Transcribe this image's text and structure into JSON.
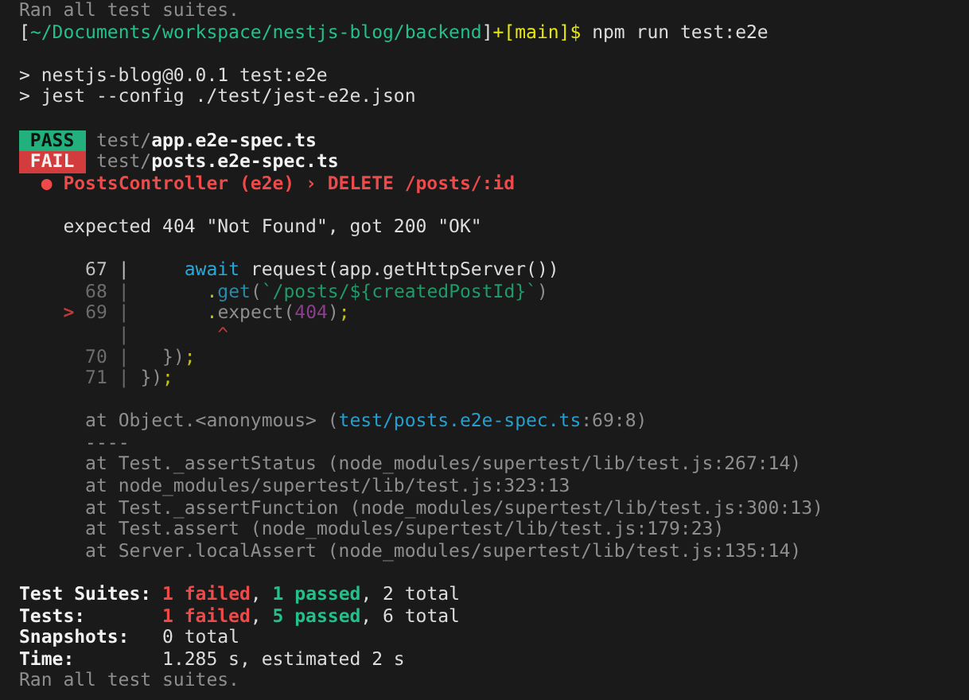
{
  "terminal": {
    "blocks": [
      {
        "lines": [
          {
            "segments": [
              {
                "kind": "dim",
                "text": "Ran all test suites."
              }
            ]
          },
          {
            "segments": [
              {
                "kind": "plain",
                "text": "["
              },
              {
                "kind": "path",
                "text": "~/Documents/workspace/nestjs-blog/backend"
              },
              {
                "kind": "plain",
                "text": "]"
              },
              {
                "kind": "branch",
                "text": "+[main]$"
              },
              {
                "kind": "plain",
                "text": " npm run test:e2e"
              }
            ]
          }
        ]
      },
      {
        "lines": [
          {
            "segments": [
              {
                "kind": "plain",
                "text": "> nestjs-blog@0.0.1 test:e2e"
              }
            ]
          },
          {
            "segments": [
              {
                "kind": "plain",
                "text": "> jest --config ./test/jest-e2e.json"
              }
            ]
          }
        ]
      },
      {
        "lines": [
          {
            "segments": [
              {
                "kind": "badge-pass",
                "text": "PASS"
              },
              {
                "kind": "dim",
                "text": " test/"
              },
              {
                "kind": "bold",
                "text": "app.e2e-spec.ts"
              }
            ]
          },
          {
            "segments": [
              {
                "kind": "badge-fail",
                "text": "FAIL"
              },
              {
                "kind": "dim",
                "text": " test/"
              },
              {
                "kind": "bold",
                "text": "posts.e2e-spec.ts"
              }
            ]
          },
          {
            "segments": [
              {
                "kind": "error",
                "text": "  ● PostsController (e2e) › DELETE /posts/:id"
              }
            ]
          }
        ]
      },
      {
        "lines": [
          {
            "segments": [
              {
                "kind": "plain",
                "text": "    expected 404 \"Not Found\", got 200 \"OK\""
              }
            ]
          }
        ]
      },
      {
        "lines": [
          {
            "segments": [
              {
                "kind": "linenum",
                "text": "      67 |"
              },
              {
                "kind": "keyword",
                "text": "     await"
              },
              {
                "kind": "plain",
                "text": " request(app.getHttpServer())"
              }
            ]
          },
          {
            "segments": [
              {
                "kind": "dimnum",
                "text": "      68 |"
              },
              {
                "kind": "punct",
                "text": "       ."
              },
              {
                "kind": "method",
                "text": "get"
              },
              {
                "kind": "dim",
                "text": "("
              },
              {
                "kind": "string",
                "text": "`/posts/${createdPostId}`"
              },
              {
                "kind": "dim",
                "text": ")"
              }
            ]
          },
          {
            "segments": [
              {
                "kind": "marker",
                "text": "    >"
              },
              {
                "kind": "dimnum",
                "text": " 69 |"
              },
              {
                "kind": "punct",
                "text": "       ."
              },
              {
                "kind": "dim",
                "text": "expect("
              },
              {
                "kind": "number",
                "text": "404"
              },
              {
                "kind": "dim",
                "text": ")"
              },
              {
                "kind": "punct",
                "text": ";"
              }
            ]
          },
          {
            "segments": [
              {
                "kind": "dimnum",
                "text": "         |"
              },
              {
                "kind": "caret",
                "text": "        ^"
              }
            ]
          },
          {
            "segments": [
              {
                "kind": "dimnum",
                "text": "      70 |"
              },
              {
                "kind": "dim",
                "text": "   })"
              },
              {
                "kind": "punct",
                "text": ";"
              }
            ]
          },
          {
            "segments": [
              {
                "kind": "dimnum",
                "text": "      71 |"
              },
              {
                "kind": "dim",
                "text": " })"
              },
              {
                "kind": "punct",
                "text": ";"
              }
            ]
          }
        ]
      },
      {
        "lines": [
          {
            "segments": [
              {
                "kind": "dim",
                "text": "      at Object.<anonymous> ("
              },
              {
                "kind": "link",
                "text": "test/posts.e2e-spec.ts"
              },
              {
                "kind": "dim",
                "text": ":69:8)"
              }
            ]
          },
          {
            "segments": [
              {
                "kind": "dim",
                "text": "      ----"
              }
            ]
          },
          {
            "segments": [
              {
                "kind": "dim",
                "text": "      at Test._assertStatus (node_modules/supertest/lib/test.js:267:14)"
              }
            ]
          },
          {
            "segments": [
              {
                "kind": "dim",
                "text": "      at node_modules/supertest/lib/test.js:323:13"
              }
            ]
          },
          {
            "segments": [
              {
                "kind": "dim",
                "text": "      at Test._assertFunction (node_modules/supertest/lib/test.js:300:13)"
              }
            ]
          },
          {
            "segments": [
              {
                "kind": "dim",
                "text": "      at Test.assert (node_modules/supertest/lib/test.js:179:23)"
              }
            ]
          },
          {
            "segments": [
              {
                "kind": "dim",
                "text": "      at Server.localAssert (node_modules/supertest/lib/test.js:135:14)"
              }
            ]
          }
        ]
      },
      {
        "lines": [
          {
            "segments": [
              {
                "kind": "label",
                "text": "Test Suites:"
              },
              {
                "kind": "failed",
                "text": " 1 failed"
              },
              {
                "kind": "plain",
                "text": ","
              },
              {
                "kind": "passed",
                "text": " 1 passed"
              },
              {
                "kind": "plain",
                "text": ", 2 total"
              }
            ]
          },
          {
            "segments": [
              {
                "kind": "label",
                "text": "Tests:"
              },
              {
                "kind": "failed",
                "text": "       1 failed"
              },
              {
                "kind": "plain",
                "text": ","
              },
              {
                "kind": "passed",
                "text": " 5 passed"
              },
              {
                "kind": "plain",
                "text": ", 6 total"
              }
            ]
          },
          {
            "segments": [
              {
                "kind": "label",
                "text": "Snapshots:"
              },
              {
                "kind": "plain",
                "text": "   0 total"
              }
            ]
          },
          {
            "segments": [
              {
                "kind": "label",
                "text": "Time:"
              },
              {
                "kind": "plain",
                "text": "        1.285 s, estimated 2 s"
              }
            ]
          },
          {
            "segments": [
              {
                "kind": "dim",
                "text": "Ran all test suites."
              }
            ]
          }
        ]
      }
    ]
  }
}
